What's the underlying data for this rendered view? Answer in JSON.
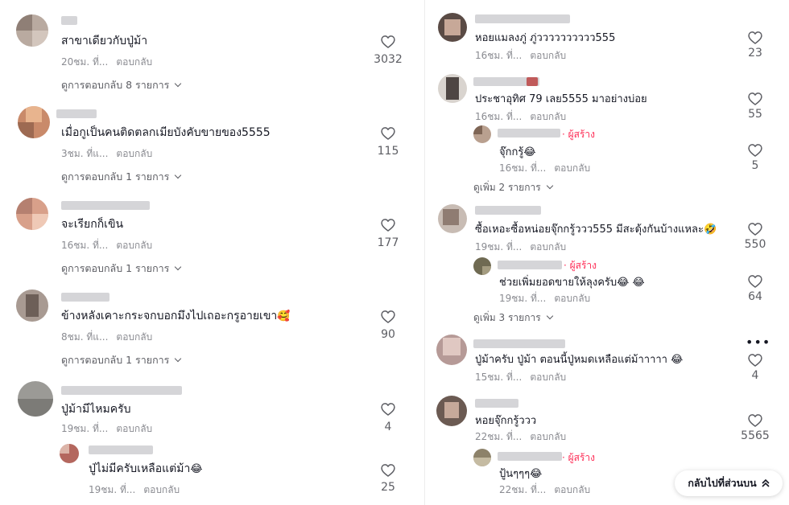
{
  "colors": {
    "creator": "#fe2c55",
    "meta": "#8a8b91",
    "text": "#161823"
  },
  "left_comments": [
    {
      "text": "สาขาเดียวกับปู่ม้า",
      "time": "20ชม. ที่...",
      "reply": "ตอบกลับ",
      "likes": "3032",
      "more": "ดูการตอบกลับ 8 รายการ"
    },
    {
      "text": "เมื่อกูเป็นคนติดตลกเมียบังคับขายของ5555",
      "time": "3ชม. ที่แ...",
      "reply": "ตอบกลับ",
      "likes": "115",
      "more": "ดูการตอบกลับ 1 รายการ"
    },
    {
      "text": "จะเรียกก็เขิน",
      "time": "16ชม. ที่...",
      "reply": "ตอบกลับ",
      "likes": "177",
      "more": "ดูการตอบกลับ 1 รายการ"
    },
    {
      "text": "ข้างหลังเคาะกระจกบอกมึงไปเถอะกรูอายเขา",
      "emoji": "🥰",
      "time": "8ชม. ที่แ...",
      "reply": "ตอบกลับ",
      "likes": "90",
      "more": "ดูการตอบกลับ 1 รายการ"
    },
    {
      "text": "ปู่ม้ามีไหมครับ",
      "time": "19ชม. ที่...",
      "reply": "ตอบกลับ",
      "likes": "4"
    }
  ],
  "left_reply": {
    "text": "ปู่ไม่มีครับเหลือแต่ม้า",
    "emoji": "😂",
    "time": "19ชม. ที่...",
    "reply": "ตอบกลับ",
    "likes": "25"
  },
  "right_comments": [
    {
      "text": "หอยแมลงภู่ ภู่วววววววววว555",
      "time": "16ชม. ที่...",
      "reply": "ตอบกลับ",
      "likes": "23"
    },
    {
      "text": "ประชาอุทิศ 79 เลย5555 มาอย่างบ่อย",
      "time": "16ชม. ที่...",
      "reply": "ตอบกลับ",
      "likes": "55"
    },
    {
      "text": "ซื้อเหอะซื้อหน่อยจุ๊กกรู้ววว555 มีสะดุ้งกันบ้างแหละ",
      "emoji": "🤣",
      "time": "19ชม. ที่...",
      "reply": "ตอบกลับ",
      "likes": "550"
    },
    {
      "text": "ปู่ม้าครับ ปู่ม้า ตอนนี้ปู่หมดเหลือแต่ม้าาาาา",
      "emoji": "😂",
      "time": "15ชม. ที่...",
      "reply": "ตอบกลับ",
      "likes": "4"
    },
    {
      "text": "หอยจุ๊กกรู้ววว",
      "time": "22ชม. ที่...",
      "reply": "ตอบกลับ",
      "likes": "5565"
    }
  ],
  "right_replies": [
    {
      "creator": "· ผู้สร้าง",
      "text": "จุ๊กกรู้",
      "emoji": "😂",
      "time": "16ชม. ที่...",
      "reply": "ตอบกลับ",
      "likes": "5",
      "more": "ดูเพิ่ม 2 รายการ"
    },
    {
      "creator": "· ผู้สร้าง",
      "text": "ช่วยเพิ่มยอดขายให้ลุงครับ",
      "emoji": "😂 😂",
      "time": "19ชม. ที่...",
      "reply": "ตอบกลับ",
      "likes": "64",
      "more": "ดูเพิ่ม 3 รายการ"
    },
    {
      "creator": "· ผู้สร้าง",
      "text": "ปู้นๆๆๆ",
      "emoji": "😂",
      "time": "22ชม. ที่...",
      "reply": "ตอบกลับ"
    }
  ],
  "back_to_top": "กลับไปที่ส่วนบน",
  "back_to_top_icon": "double-chevron-up-icon",
  "more_icon": "ellipsis-icon"
}
